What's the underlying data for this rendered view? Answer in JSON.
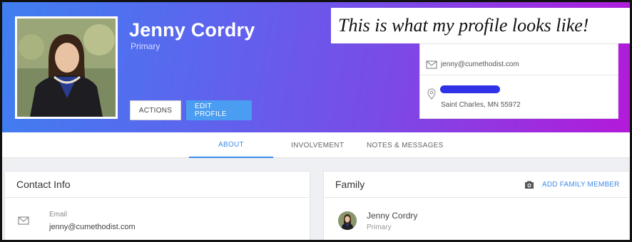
{
  "profile": {
    "name": "Jenny Cordry",
    "role": "Primary",
    "actions_label": "ACTIONS",
    "edit_label": "EDIT PROFILE"
  },
  "caption": "This is what my profile looks like!",
  "contact_card": {
    "email": "jenny@cumethodist.com",
    "address": "Saint Charles, MN 55972"
  },
  "tabs": [
    {
      "label": "ABOUT",
      "active": true
    },
    {
      "label": "INVOLVEMENT",
      "active": false
    },
    {
      "label": "NOTES & MESSAGES",
      "active": false
    }
  ],
  "contact_info": {
    "title": "Contact Info",
    "email_label": "Email",
    "email_value": "jenny@cumethodist.com"
  },
  "family": {
    "title": "Family",
    "add_label": "ADD FAMILY MEMBER",
    "member_name": "Jenny Cordry",
    "member_role": "Primary"
  },
  "icons": {
    "mail": "mail-icon",
    "location": "location-pin-icon",
    "camera": "camera-icon"
  },
  "colors": {
    "accent": "#3d8ce8",
    "edit_button": "#4a9df0",
    "banner_start": "#3f7ff0",
    "banner_end": "#b31ad9",
    "redaction": "#2f32e6"
  }
}
